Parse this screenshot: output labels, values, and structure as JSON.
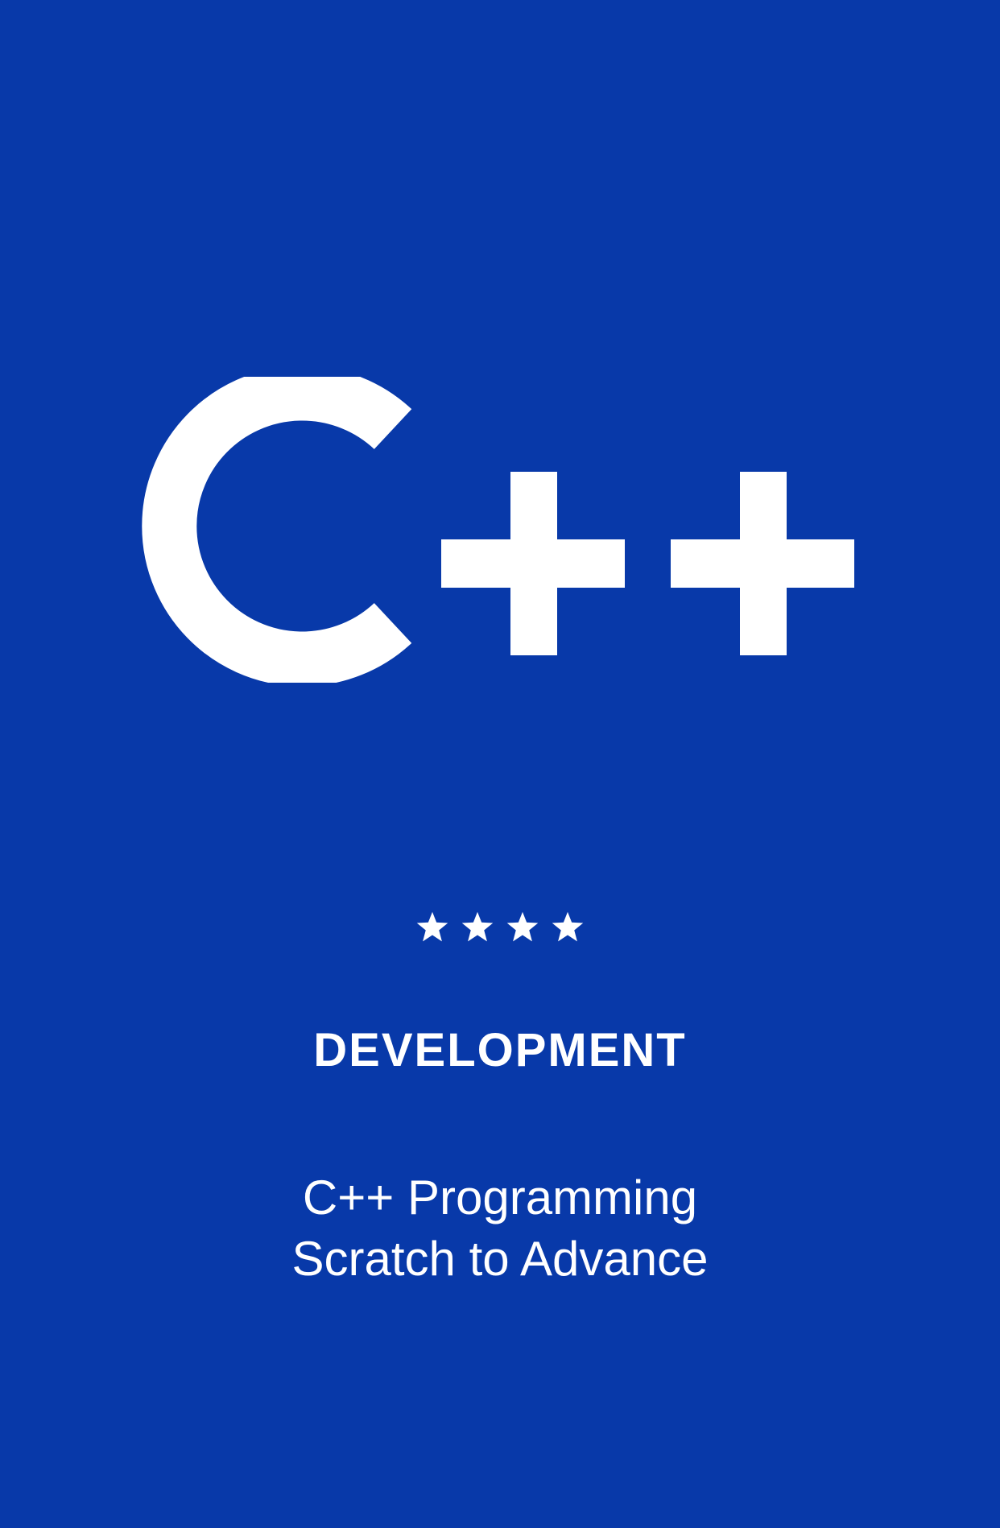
{
  "card": {
    "background_color": "#0839a9",
    "foreground_color": "#ffffff",
    "logo_text": "C++",
    "rating": {
      "stars": 4,
      "icon": "star-icon"
    },
    "category": "DEVELOPMENT",
    "title_line_1": "C++ Programming",
    "title_line_2": "Scratch to Advance"
  }
}
